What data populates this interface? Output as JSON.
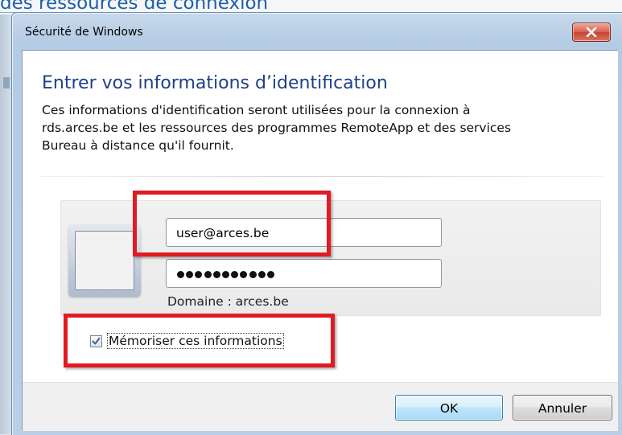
{
  "background": {
    "heading_fragment": "des ressources de connexion"
  },
  "window": {
    "title": "Sécurité de Windows",
    "close_icon": "close-x-icon"
  },
  "dialog": {
    "heading": "Entrer vos informations d’identification",
    "description_lines": [
      "Ces informations d'identification seront utilisées pour la connexion à",
      "rds.arces.be et les ressources des programmes RemoteApp et des services",
      "Bureau à distance qu'il fournit."
    ]
  },
  "credentials": {
    "username_value": "user@arces.be",
    "password_mask_count": 11,
    "domain_label": "Domaine : arces.be"
  },
  "remember": {
    "checked": true,
    "label": "Mémoriser ces informations"
  },
  "buttons": {
    "ok_label": "OK",
    "cancel_label": "Annuler"
  },
  "colors": {
    "heading": "#1e3f8a",
    "highlight": "#e01b22",
    "close_button": "#c9503c"
  }
}
